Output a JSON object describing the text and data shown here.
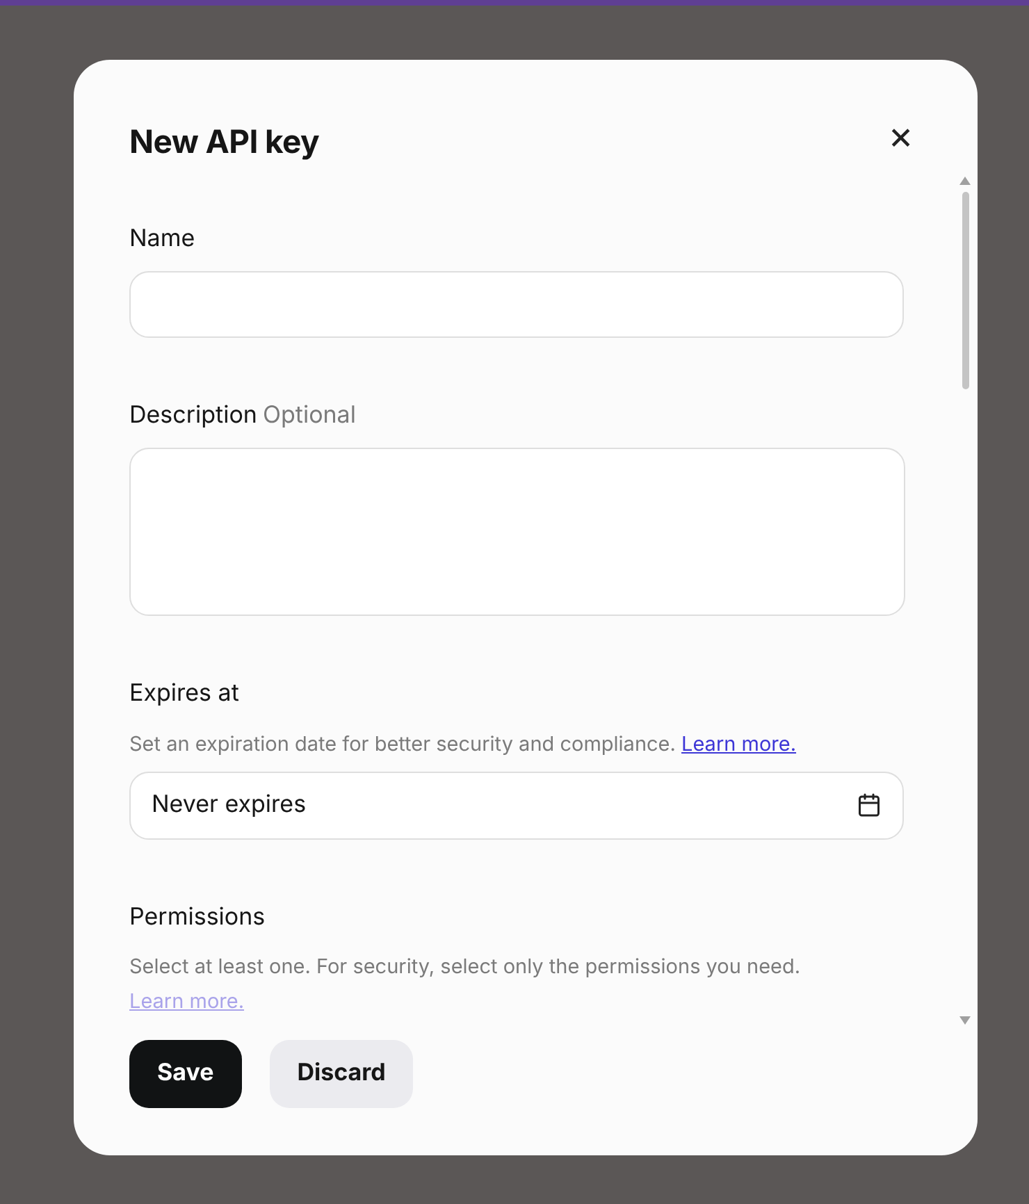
{
  "dialog": {
    "title": "New API key",
    "close_icon": "×"
  },
  "fields": [
    {
      "kind": "input",
      "label": "Name"
    },
    {
      "kind": "textarea",
      "label": "Description",
      "optional": "Optional"
    },
    {
      "kind": "date",
      "label": "Expires at",
      "hint": "Set an expiration date for better security and compliance.",
      "link": "Learn more.",
      "value": "Never expires"
    },
    {
      "kind": "section",
      "label": "Permissions",
      "hint": "Select at least one. For security, select only the permissions you need.",
      "link": "Learn more.",
      "link_faded": true
    }
  ],
  "buttons": [
    {
      "label": "Save",
      "kind": "primary"
    },
    {
      "label": "Discard",
      "kind": "secondary"
    }
  ]
}
